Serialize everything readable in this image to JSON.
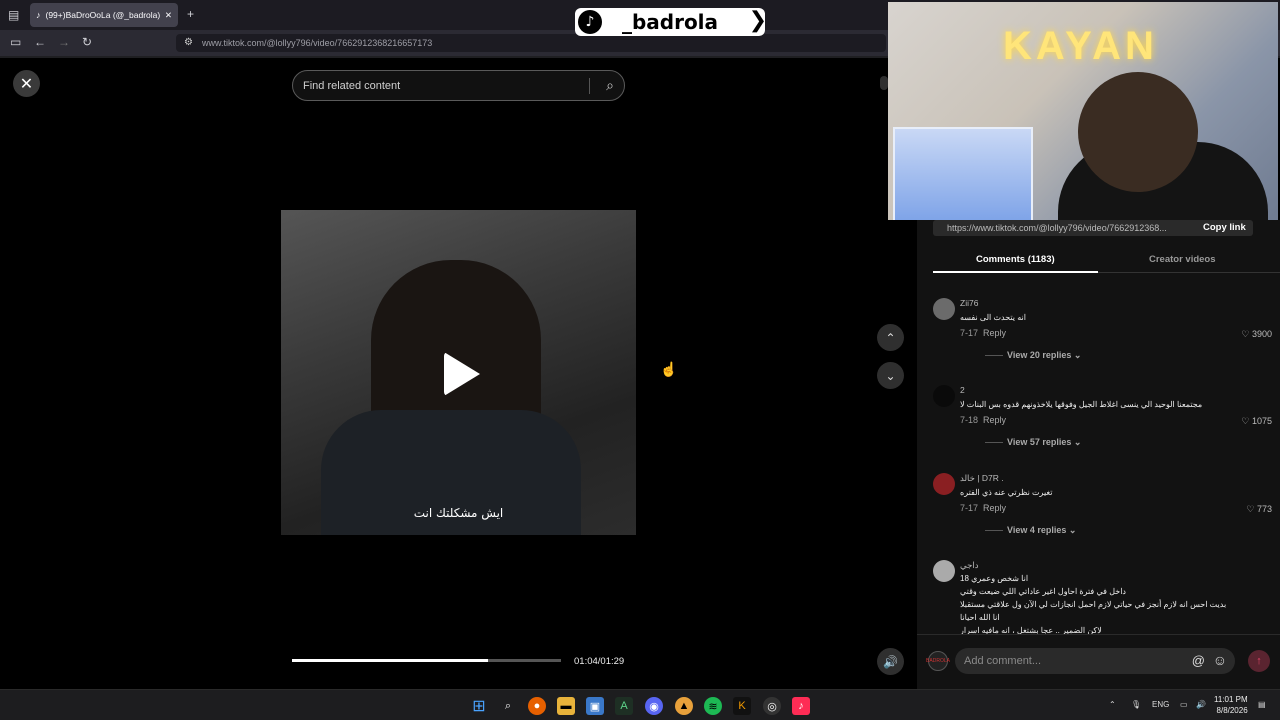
{
  "browser": {
    "tab_title": "(99+)BaDroOoLa (@_badrola) |",
    "url": "www.tiktok.com/@lollyy796/video/7662912368216657173"
  },
  "brand": {
    "name": "_badrola"
  },
  "viewer": {
    "search_placeholder": "Find related content",
    "subtitle": "ايش مشكلتك انت",
    "progress": 0.728,
    "time": "01:04/01:29"
  },
  "stream_overlay": {
    "neon_text": "KAYAN"
  },
  "panel": {
    "link": "https://www.tiktok.com/@lollyy796/video/7662912368...",
    "copy_label": "Copy link",
    "tab_comments": "Comments (1183)",
    "tab_creator": "Creator videos",
    "comments": [
      {
        "name": "Zii76",
        "text": "انه يتحدث الى نفسه",
        "date": "7-17",
        "reply": "Reply",
        "likes": "3900",
        "view": "View 20 replies"
      },
      {
        "name": "2",
        "text": "مجتمعنا الوحيد الي ينسى اغلاط الجيل وفوقها يلاخذونهم قدوه بس البنات لا",
        "date": "7-18",
        "reply": "Reply",
        "likes": "1075",
        "view": "View 57 replies"
      },
      {
        "name": "خالد | D7R .",
        "text": "تغيرت نظرتي عنه ذي الفتره",
        "date": "7-17",
        "reply": "Reply",
        "likes": "773",
        "view": "View 4 replies"
      },
      {
        "name": "داجي",
        "line1": "انا شخص وعمري 18",
        "line2": "داخل في فترة احاول اغير عاداتي اللي ضيعت وقتي",
        "line3": "بديت احس انه لازم أنجز في حياتي لازم احمل انجازات لي الآن ول علاقتي مستقبلا",
        "line4": "انا الله احيانا",
        "line5": "لاكن الضمير .. عجا بشتغل ، انه مافيه اسرار"
      }
    ],
    "add_comment": "Add comment..."
  },
  "taskbar": {
    "lang": "ENG",
    "time": "11:01 PM",
    "date": "8/8/2026"
  }
}
